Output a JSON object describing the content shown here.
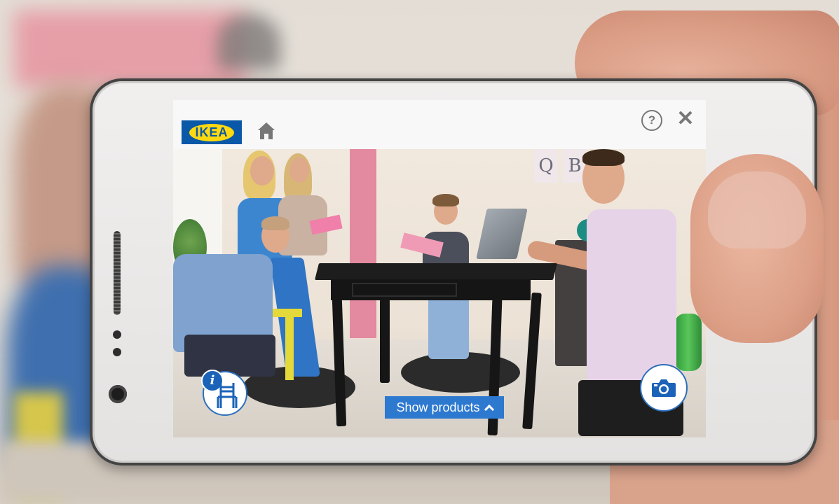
{
  "app": {
    "logo_text": "IKEA",
    "brand_colors": {
      "blue": "#0a58a8",
      "yellow": "#ffd90f"
    }
  },
  "topbar": {
    "icons": [
      "home-icon",
      "help-icon",
      "close-icon"
    ],
    "help_glyph": "?",
    "close_glyph": "✕"
  },
  "scene": {
    "wall_letters": [
      "Q",
      "B"
    ]
  },
  "overlay": {
    "info_glyph": "i",
    "show_products_label": "Show products",
    "accent": "#2d79cf",
    "icons": [
      "chair-icon",
      "chevron-up-icon",
      "camera-icon"
    ]
  }
}
